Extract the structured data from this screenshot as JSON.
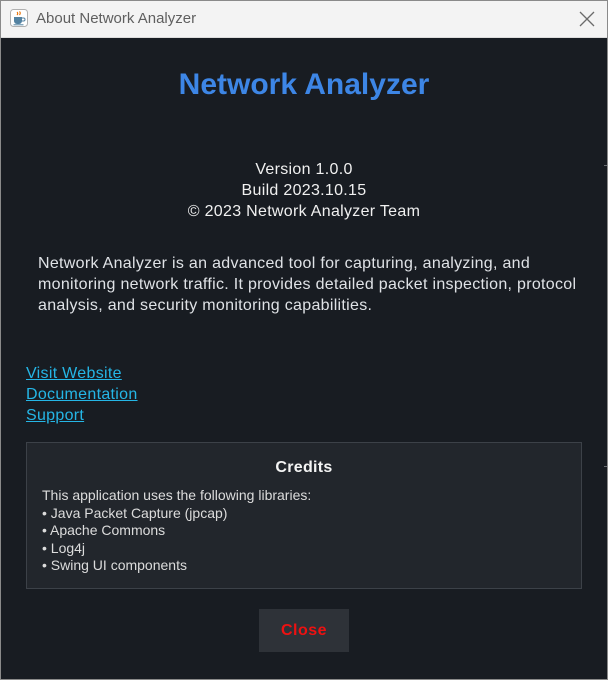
{
  "window": {
    "title": "About Network Analyzer"
  },
  "header": {
    "app_name": "Network Analyzer"
  },
  "version_info": {
    "version": "Version 1.0.0",
    "build": "Build 2023.10.15",
    "copyright": "© 2023 Network Analyzer Team"
  },
  "description": "Network Analyzer is an advanced tool for capturing, analyzing, and monitoring network traffic. It provides detailed packet inspection, protocol analysis, and security monitoring capabilities.",
  "links": [
    {
      "label": "Visit Website"
    },
    {
      "label": "Documentation"
    },
    {
      "label": "Support"
    }
  ],
  "credits": {
    "title": "Credits",
    "intro": "This application uses the following libraries:",
    "libraries": [
      "• Java Packet Capture (jpcap)",
      "• Apache Commons",
      "• Log4j",
      "• Swing UI components"
    ]
  },
  "footer": {
    "close_label": "Close"
  },
  "colors": {
    "background": "#181c22",
    "title_accent": "#3d86e6",
    "link": "#25b6e6",
    "close_text": "#ee1111",
    "panel": "#22262c"
  },
  "icons": {
    "app": "java-coffee-cup-icon",
    "close": "close-icon"
  }
}
